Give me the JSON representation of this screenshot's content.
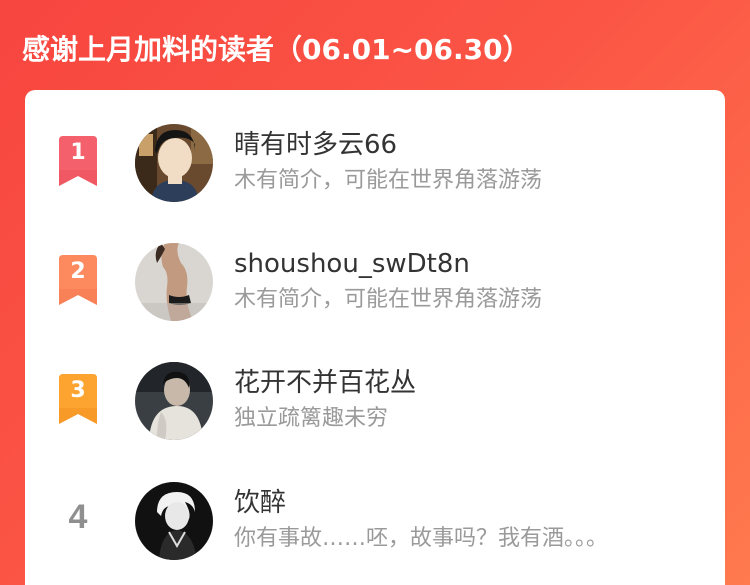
{
  "header": {
    "title": "感谢上月加料的读者（06.01~06.30）"
  },
  "readers": [
    {
      "rank": "1",
      "name": "晴有时多云66",
      "bio": "木有简介，可能在世界角落游荡"
    },
    {
      "rank": "2",
      "name": "shoushou_swDt8n",
      "bio": "木有简介，可能在世界角落游荡"
    },
    {
      "rank": "3",
      "name": "花开不并百花丛",
      "bio": "独立疏篱趣未穷"
    },
    {
      "rank": "4",
      "name": "饮醉",
      "bio": "你有事故……呸，故事吗？我有酒。。。"
    }
  ],
  "colors": {
    "rank1": "#f4606b",
    "rank2": "#fd8a5e",
    "rank3": "#fca330",
    "rank_plain": "#8f8f8f"
  }
}
